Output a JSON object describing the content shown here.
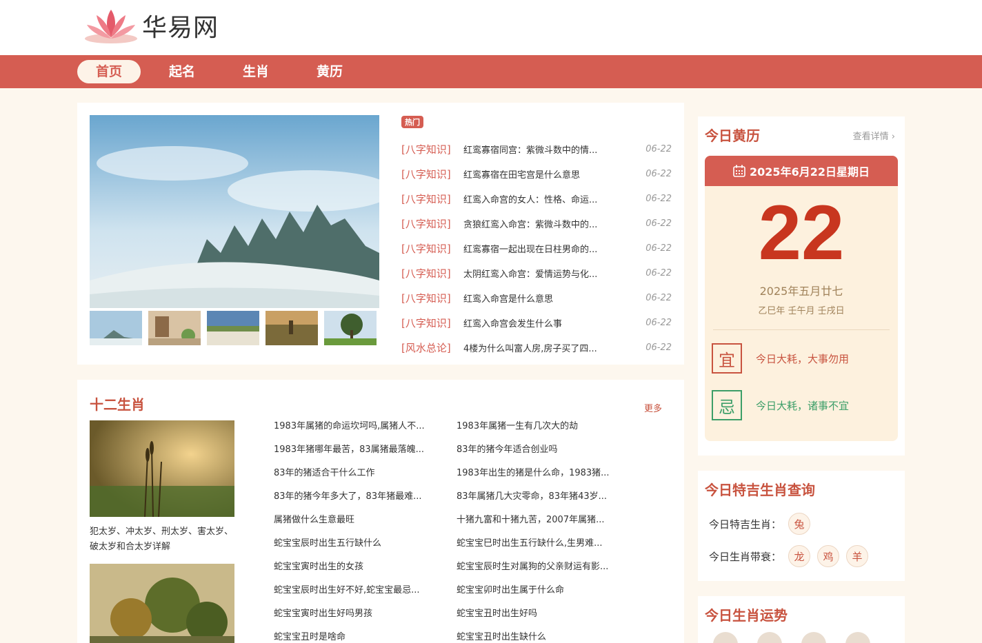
{
  "site": {
    "name": "华易网"
  },
  "nav": [
    {
      "label": "首页",
      "active": true
    },
    {
      "label": "起名",
      "active": false
    },
    {
      "label": "生肖",
      "active": false
    },
    {
      "label": "黄历",
      "active": false
    }
  ],
  "hot": {
    "badge": "热门",
    "items": [
      {
        "cat": "[八字知识]",
        "title": "红鸾寡宿同宫：紫微斗数中的情...",
        "date": "06-22"
      },
      {
        "cat": "[八字知识]",
        "title": "红鸾寡宿在田宅宫是什么意思",
        "date": "06-22"
      },
      {
        "cat": "[八字知识]",
        "title": "红鸾入命宫的女人：性格、命运...",
        "date": "06-22"
      },
      {
        "cat": "[八字知识]",
        "title": "贪狼红鸾入命宫：紫微斗数中的...",
        "date": "06-22"
      },
      {
        "cat": "[八字知识]",
        "title": "红鸾寡宿一起出现在日柱男命的...",
        "date": "06-22"
      },
      {
        "cat": "[八字知识]",
        "title": "太阴红鸾入命宫：爱情运势与化...",
        "date": "06-22"
      },
      {
        "cat": "[八字知识]",
        "title": "红鸾入命宫是什么意思",
        "date": "06-22"
      },
      {
        "cat": "[八字知识]",
        "title": "红鸾入命宫会发生什么事",
        "date": "06-22"
      },
      {
        "cat": "[风水总论]",
        "title": "4楼为什么叫富人房,房子买了四...",
        "date": "06-22"
      }
    ]
  },
  "zodiac": {
    "title": "十二生肖",
    "more": "更多",
    "feature_caption": "犯太岁、冲太岁、刑太岁、害太岁、破太岁和合太岁详解",
    "links_left": [
      "1983年属猪的命运坎坷吗,属猪人不...",
      "1983年猪哪年最苦，83属猪最落魄...",
      "83年的猪适合干什么工作",
      "83年的猪今年多大了，83年猪最难...",
      "属猪做什么生意最旺",
      "蛇宝宝辰时出生五行缺什么",
      "蛇宝宝寅时出生的女孩",
      "蛇宝宝辰时出生好不好,蛇宝宝最忌...",
      "蛇宝宝寅时出生好吗男孩",
      "蛇宝宝丑时是啥命"
    ],
    "links_right": [
      "1983年属猪一生有几次大的劫",
      "83年的猪今年适合创业吗",
      "1983年出生的猪是什么命，1983猪...",
      "83年属猪几大灾零命，83年猪43岁...",
      "十猪九富和十猪九苦，2007年属猪...",
      "蛇宝宝巳时出生五行缺什么,生男难...",
      "蛇宝宝辰时生对属狗的父亲财运有影...",
      "蛇宝宝卯时出生属于什么命",
      "蛇宝宝丑时出生好吗",
      "蛇宝宝丑时出生缺什么"
    ]
  },
  "almanac": {
    "title": "今日黄历",
    "detail": "查看详情",
    "date_line": "2025年6月22日星期日",
    "day": "22",
    "lunar": "2025年五月廿七",
    "ganzhi": "乙巳年 壬午月 壬戌日",
    "yi_label": "宜",
    "yi_text": "今日大耗，大事勿用",
    "ji_label": "忌",
    "ji_text": "今日大耗，诸事不宜",
    "yi_color": "#c8533f",
    "ji_color": "#3c9e68"
  },
  "lucky": {
    "title": "今日特吉生肖查询",
    "best_label": "今日特吉生肖：",
    "best": [
      "兔"
    ],
    "bad_label": "今日生肖带衰：",
    "bad": [
      "龙",
      "鸡",
      "羊"
    ]
  },
  "fortune": {
    "title": "今日生肖运势"
  }
}
